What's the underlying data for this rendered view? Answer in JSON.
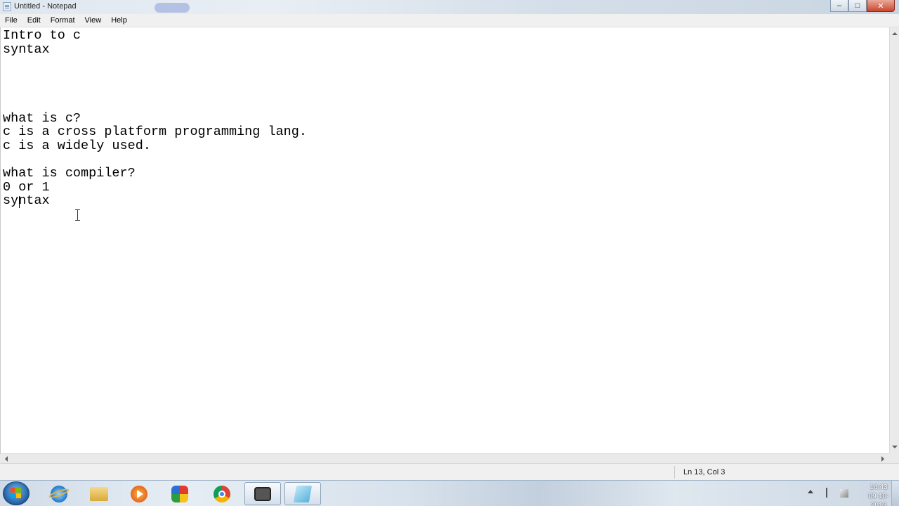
{
  "window": {
    "title": "Untitled - Notepad",
    "buttons": {
      "minimize": "–",
      "maximize": "□",
      "close": "✕"
    }
  },
  "menu": {
    "items": [
      "File",
      "Edit",
      "Format",
      "View",
      "Help"
    ]
  },
  "editor": {
    "text": "Intro to c\nsyntax\n\n\n\n\nwhat is c?\nc is a cross platform programming lang.\nc is a widely used.\n\nwhat is compiler?\n0 or 1\nsyntax"
  },
  "status": {
    "position": "Ln 13, Col 3"
  },
  "taskbar": {
    "apps": [
      {
        "name": "internet-explorer-icon"
      },
      {
        "name": "folder-icon"
      },
      {
        "name": "media-player-icon"
      },
      {
        "name": "paint-icon"
      },
      {
        "name": "chrome-icon"
      },
      {
        "name": "video-recorder-icon"
      },
      {
        "name": "notepad-icon"
      }
    ],
    "clock": {
      "time": "14:43",
      "date": "09-10-2013"
    }
  },
  "colors": {
    "start_orb": "#2f6fb2",
    "close_button": "#c9452e"
  }
}
